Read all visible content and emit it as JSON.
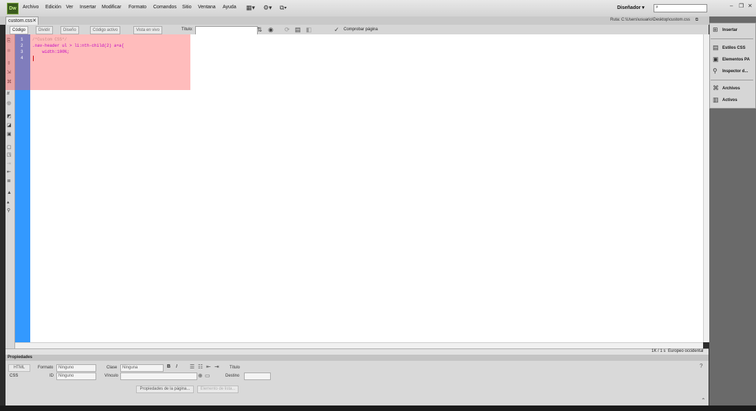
{
  "app": {
    "logo_text": "Dw"
  },
  "menubar": {
    "items": [
      "Archivo",
      "Edición",
      "Ver",
      "Insertar",
      "Modificar",
      "Formato",
      "Comandos",
      "Sitio",
      "Ventana",
      "Ayuda"
    ],
    "workspace_label": "Diseñador",
    "window_controls": [
      "–",
      "❐",
      "✕"
    ]
  },
  "document": {
    "tab_label": "custom.css",
    "tab_close": "✕",
    "path_label": "Ruta:",
    "path_value": "C:\\Users\\usuario\\Desktop\\custom.css"
  },
  "doc_toolbar": {
    "code_label": "Código",
    "split_label": "Dividir",
    "design_label": "Diseño",
    "live_code_label": "Código activo",
    "live_view_label": "Vista en vivo",
    "title_label": "Título:",
    "title_value": "",
    "check_page_label": "Comprobar página"
  },
  "editor": {
    "line_numbers": [
      "1",
      "2",
      "3",
      "4"
    ],
    "lines": [
      "/*Custom CSS*/",
      ".nav-header ul > li:nth-child(2) a+a{",
      "    width:100%;",
      ""
    ],
    "line_colors": [
      "#c98a8a",
      "#c200c2",
      "#c200c2",
      "#000000"
    ]
  },
  "statusbar": {
    "size_time": "1K / 1 s",
    "encoding": "Europeo occidental"
  },
  "properties": {
    "panel_title": "Propiedades",
    "html_btn": "HTML",
    "css_btn": "CSS",
    "format_label": "Formato",
    "format_value": "Ninguno",
    "id_label": "ID",
    "id_value": "Ninguno",
    "class_label": "Clase",
    "class_value": "Ninguna",
    "link_label": "Vínculo",
    "link_value": "",
    "title_label": "Título",
    "target_label": "Destino",
    "bold": "B",
    "italic": "I",
    "page_props_btn": "Propiedades de la página...",
    "list_item_btn": "Elemento de lista..."
  },
  "right_panel": {
    "items": [
      "Insertar",
      "Estilos CSS",
      "Elementos PA",
      "Inspector d...",
      "Archivos",
      "Activos"
    ]
  },
  "colors": {
    "gutter": "#3399ff",
    "highlight": "#ff5050",
    "code_keyword": "#c200c2",
    "comment": "#c98a8a"
  }
}
